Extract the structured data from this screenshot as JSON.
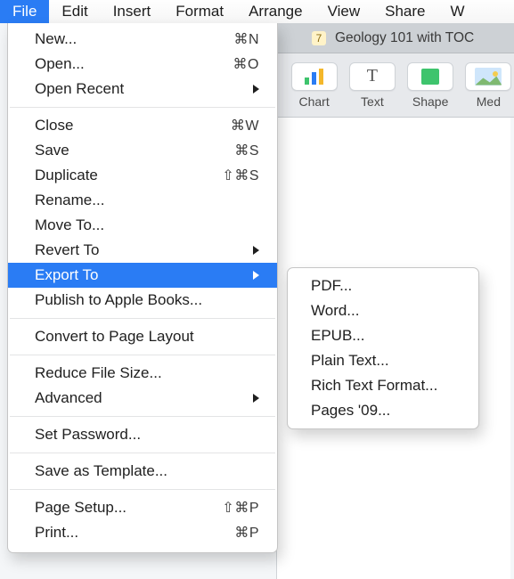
{
  "menubar": {
    "items": [
      {
        "label": "File",
        "active": true
      },
      {
        "label": "Edit"
      },
      {
        "label": "Insert"
      },
      {
        "label": "Format"
      },
      {
        "label": "Arrange"
      },
      {
        "label": "View"
      },
      {
        "label": "Share"
      },
      {
        "label": "W"
      }
    ]
  },
  "tab": {
    "icon": "7",
    "title": "Geology 101 with TOC"
  },
  "toolbar": {
    "chart": "Chart",
    "text": "Text",
    "shape": "Shape",
    "media": "Med"
  },
  "fileMenu": {
    "new_": {
      "label": "New...",
      "short": "⌘N"
    },
    "open_": {
      "label": "Open...",
      "short": "⌘O"
    },
    "openRecent": {
      "label": "Open Recent"
    },
    "close": {
      "label": "Close",
      "short": "⌘W"
    },
    "save": {
      "label": "Save",
      "short": "⌘S"
    },
    "duplicate": {
      "label": "Duplicate",
      "short": "⇧⌘S"
    },
    "rename": {
      "label": "Rename..."
    },
    "moveTo": {
      "label": "Move To..."
    },
    "revertTo": {
      "label": "Revert To"
    },
    "exportTo": {
      "label": "Export To"
    },
    "publish": {
      "label": "Publish to Apple Books..."
    },
    "convert": {
      "label": "Convert to Page Layout"
    },
    "reduce": {
      "label": "Reduce File Size..."
    },
    "advanced": {
      "label": "Advanced"
    },
    "setPassword": {
      "label": "Set Password..."
    },
    "saveAsTpl": {
      "label": "Save as Template..."
    },
    "pageSetup": {
      "label": "Page Setup...",
      "short": "⇧⌘P"
    },
    "print": {
      "label": "Print...",
      "short": "⌘P"
    }
  },
  "exportSubmenu": {
    "pdf": {
      "label": "PDF..."
    },
    "word": {
      "label": "Word..."
    },
    "epub": {
      "label": "EPUB..."
    },
    "plain": {
      "label": "Plain Text..."
    },
    "rtf": {
      "label": "Rich Text Format..."
    },
    "p09": {
      "label": "Pages '09..."
    }
  }
}
